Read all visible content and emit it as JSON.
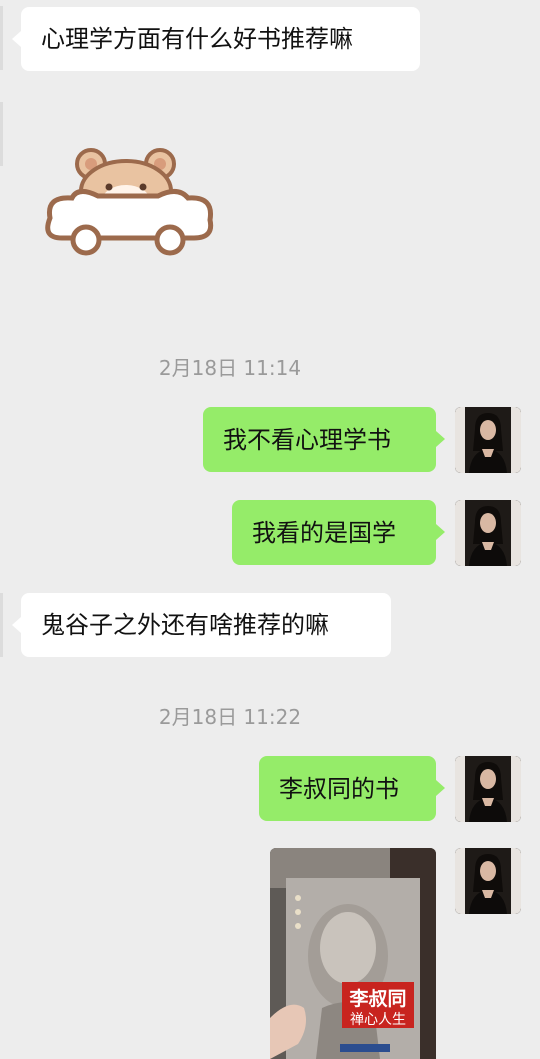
{
  "messages": [
    {
      "side": "in",
      "type": "text",
      "text": "心理学方面有什么好书推荐嘛"
    },
    {
      "side": "in",
      "type": "sticker",
      "sticker": "hamster-in-cloud-car"
    },
    {
      "side": "time",
      "text": "2月18日 11:14"
    },
    {
      "side": "out",
      "type": "text",
      "text": "我不看心理学书"
    },
    {
      "side": "out",
      "type": "text",
      "text": "我看的是国学"
    },
    {
      "side": "in",
      "type": "text",
      "text": "鬼谷子之外还有啥推荐的嘛"
    },
    {
      "side": "time",
      "text": "2月18日 11:22"
    },
    {
      "side": "out",
      "type": "text",
      "text": "李叔同的书"
    },
    {
      "side": "out",
      "type": "image",
      "image": {
        "title": "李叔同",
        "subtitle": "禅心人生"
      }
    }
  ],
  "colors": {
    "background": "#ededed",
    "incoming_bubble": "#ffffff",
    "outgoing_bubble": "#95ec69",
    "timestamp": "#9a9a9a"
  },
  "icons": {
    "avatar": "user-avatar-photo"
  }
}
